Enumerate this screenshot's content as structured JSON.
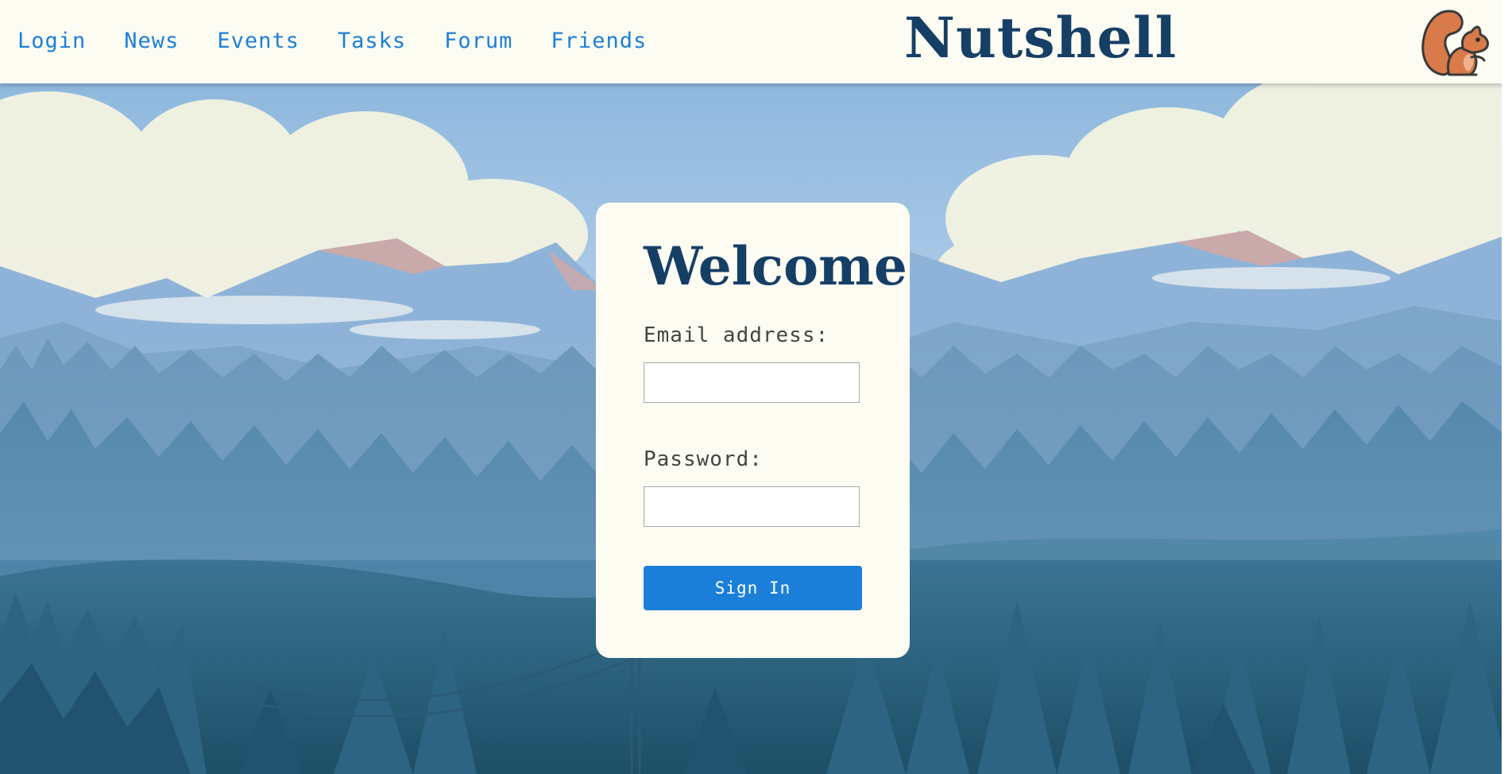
{
  "nav": {
    "items": [
      {
        "label": "Login"
      },
      {
        "label": "News"
      },
      {
        "label": "Events"
      },
      {
        "label": "Tasks"
      },
      {
        "label": "Forum"
      },
      {
        "label": "Friends"
      }
    ]
  },
  "brand": {
    "title": "Nutshell",
    "logo_icon": "squirrel-icon"
  },
  "login": {
    "heading": "Welcome",
    "email_label": "Email address:",
    "email_value": "",
    "password_label": "Password:",
    "password_value": "",
    "submit_label": "Sign In"
  },
  "colors": {
    "header_bg": "#fcfcf3",
    "link": "#1b7fd9",
    "brand": "#163f66",
    "button": "#1b7fd9",
    "card_bg": "#fcfcf3"
  }
}
